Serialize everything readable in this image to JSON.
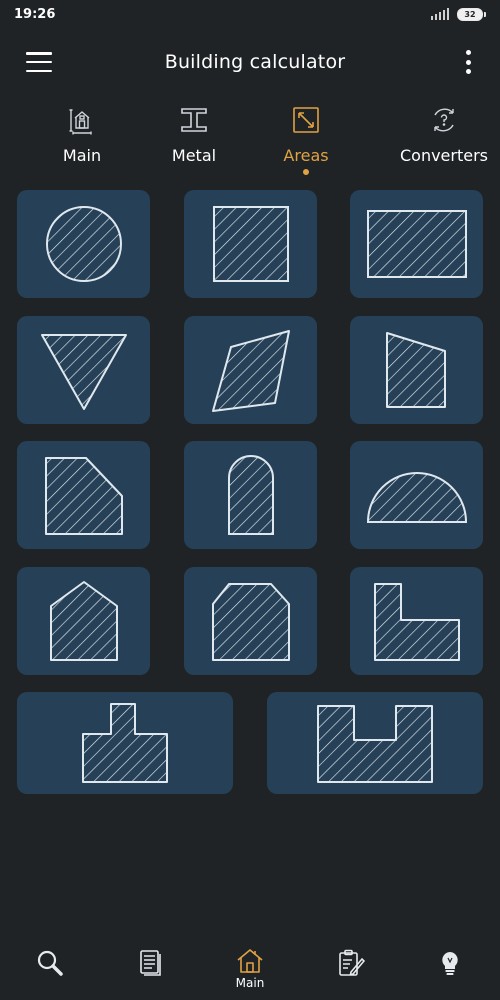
{
  "status_bar": {
    "time": "19:26",
    "battery": "32"
  },
  "app_bar": {
    "title": "Building calculator",
    "menu_icon": "hamburger-menu-icon",
    "more_icon": "more-vertical-icon"
  },
  "tabs": [
    {
      "label": "Main",
      "icon": "house-measure-icon",
      "active": false
    },
    {
      "label": "Metal",
      "icon": "i-beam-icon",
      "active": false
    },
    {
      "label": "Areas",
      "icon": "area-resize-icon",
      "active": true
    },
    {
      "label": "Converters",
      "icon": "converter-icon",
      "active": false
    }
  ],
  "shapes": [
    "circle",
    "square",
    "rectangle",
    "triangle",
    "parallelogram",
    "trapezoid",
    "cut-corner",
    "arch",
    "semicircle",
    "pentagon",
    "octagon",
    "l-shape",
    "t-shape",
    "u-shape"
  ],
  "colors": {
    "background": "#1f2326",
    "card": "#264157",
    "accent": "#e0a243",
    "stroke": "#dfe8ef"
  },
  "bottom_nav": [
    {
      "icon": "search-icon",
      "label": ""
    },
    {
      "icon": "documents-icon",
      "label": ""
    },
    {
      "icon": "home-icon",
      "label": "Main",
      "active": true
    },
    {
      "icon": "clipboard-edit-icon",
      "label": ""
    },
    {
      "icon": "lightbulb-icon",
      "label": ""
    }
  ]
}
